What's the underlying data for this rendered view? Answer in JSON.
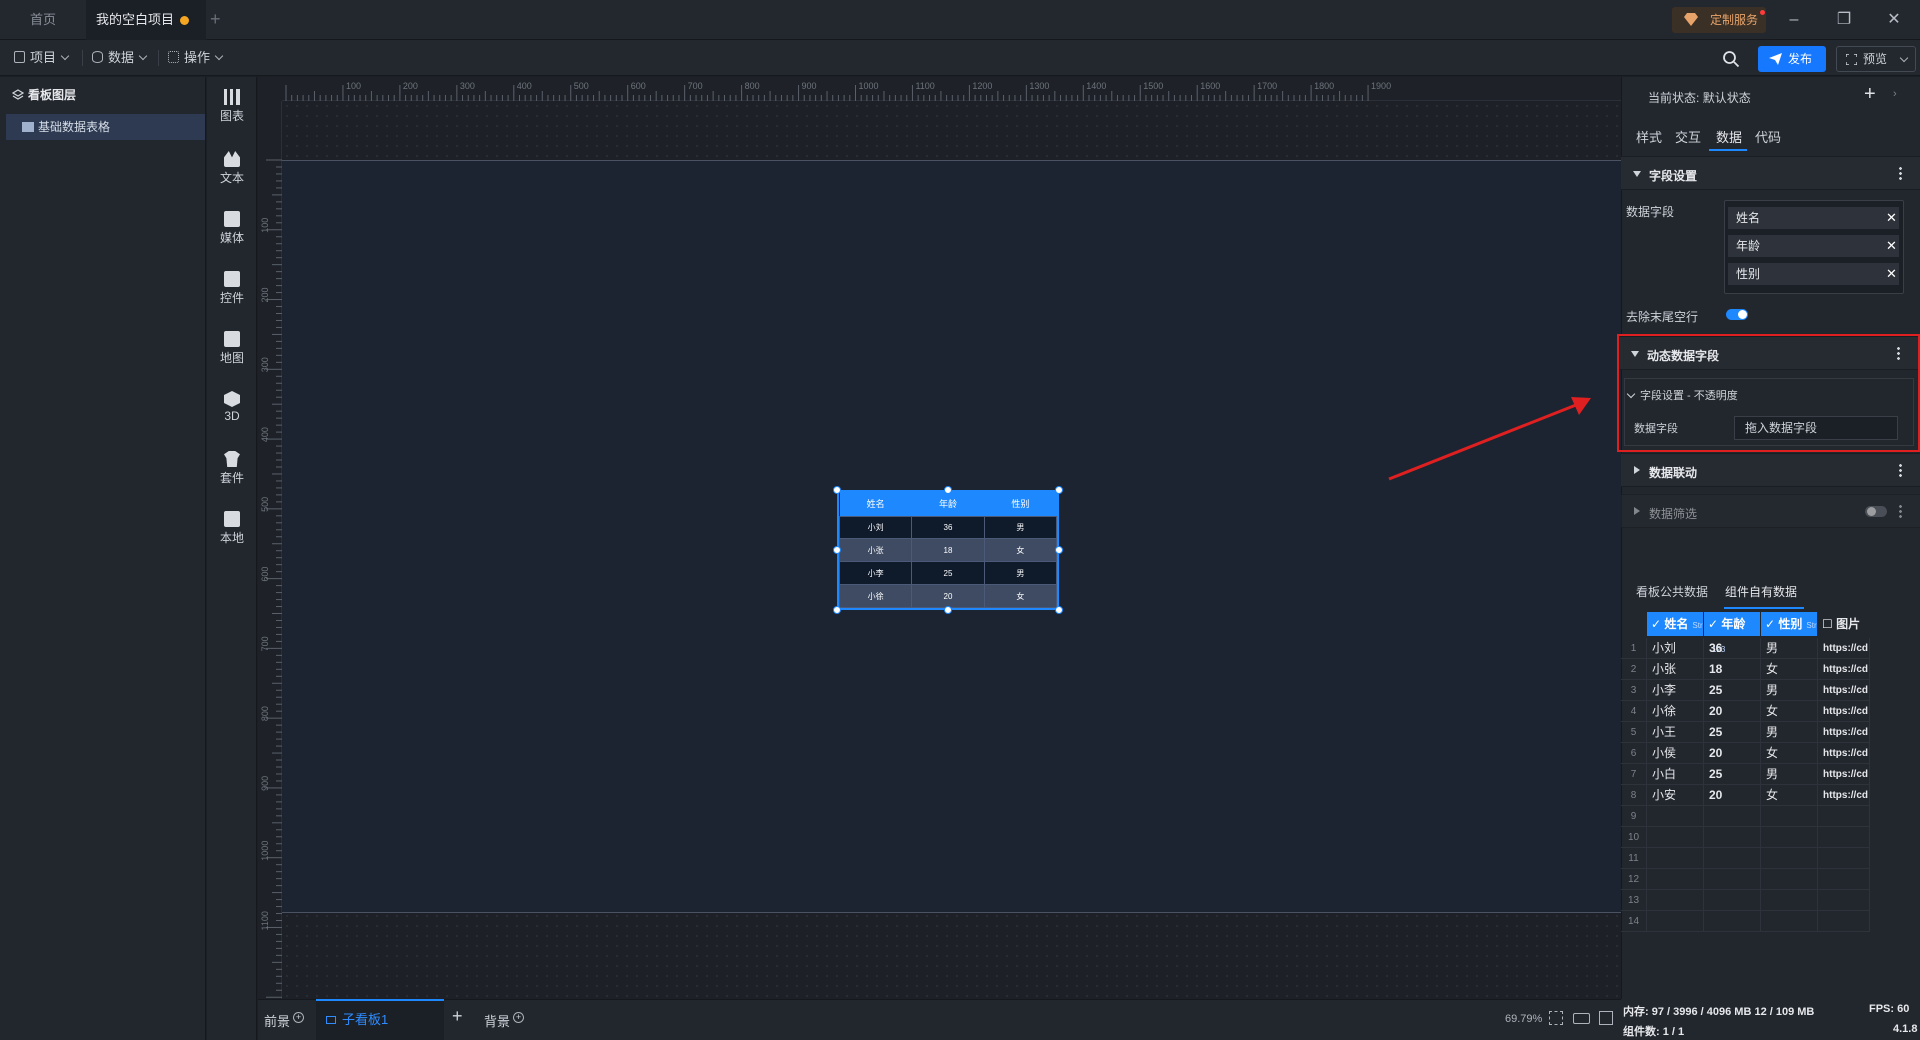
{
  "tabs": [
    {
      "label": "首页"
    },
    {
      "label": "我的空白项目"
    }
  ],
  "vip": {
    "label": "定制服务"
  },
  "toolbar": {
    "project": "项目",
    "data": "数据",
    "ops": "操作",
    "publish": "发布",
    "preview": "预览"
  },
  "layers": {
    "title": "看板图层",
    "items": [
      "基础数据表格"
    ]
  },
  "components": [
    "图表",
    "文本",
    "媒体",
    "控件",
    "地图",
    "3D",
    "套件",
    "本地"
  ],
  "ruler": {
    "top": [
      "100",
      "200",
      "300",
      "400",
      "500",
      "600",
      "700",
      "800",
      "900",
      "1000",
      "1100",
      "1200",
      "1300",
      "1400",
      "1500",
      "1600",
      "1700",
      "1800",
      "1900"
    ],
    "left": [
      "100",
      "200",
      "300",
      "400",
      "500",
      "600",
      "700",
      "800",
      "900",
      "1000",
      "1100"
    ]
  },
  "table_widget": {
    "headers": [
      "姓名",
      "年龄",
      "性别"
    ],
    "rows": [
      [
        "小刘",
        "36",
        "男"
      ],
      [
        "小张",
        "18",
        "女"
      ],
      [
        "小李",
        "25",
        "男"
      ],
      [
        "小徐",
        "20",
        "女"
      ]
    ]
  },
  "bottom": {
    "foreground": "前景",
    "sub_board": "子看板1",
    "background": "背景",
    "zoom": "69.79%"
  },
  "right": {
    "state_label": "当前状态:",
    "state_value": "默认状态",
    "tabs": [
      "样式",
      "交互",
      "数据",
      "代码"
    ],
    "field_settings": "字段设置",
    "data_field_label": "数据字段",
    "fields": [
      "姓名",
      "年龄",
      "性别"
    ],
    "trim_label": "去除末尾空行",
    "trim_on": true,
    "dynamic_title": "动态数据字段",
    "dynamic_sub": "字段设置 - 不透明度",
    "dynamic_field_label": "数据字段",
    "dynamic_placeholder": "拖入数据字段",
    "linkage": "数据联动",
    "filter": "数据筛选",
    "filter_on": false,
    "data_tabs": [
      "看板公共数据",
      "组件自有数据"
    ],
    "grid_headers": [
      {
        "name": "姓名",
        "type": "Str",
        "checked": true
      },
      {
        "name": "年龄",
        "type": "123",
        "checked": true
      },
      {
        "name": "性别",
        "type": "Str",
        "checked": true
      },
      {
        "name": "图片",
        "type": "",
        "checked": false
      }
    ],
    "grid_rows": [
      [
        "1",
        "小刘",
        "36",
        "男",
        "https://cd"
      ],
      [
        "2",
        "小张",
        "18",
        "女",
        "https://cd"
      ],
      [
        "3",
        "小李",
        "25",
        "男",
        "https://cd"
      ],
      [
        "4",
        "小徐",
        "20",
        "女",
        "https://cd"
      ],
      [
        "5",
        "小王",
        "25",
        "男",
        "https://cd"
      ],
      [
        "6",
        "小侯",
        "20",
        "女",
        "https://cd"
      ],
      [
        "7",
        "小白",
        "25",
        "男",
        "https://cd"
      ],
      [
        "8",
        "小安",
        "20",
        "女",
        "https://cd"
      ],
      [
        "9",
        "",
        "",
        "",
        ""
      ],
      [
        "10",
        "",
        "",
        "",
        ""
      ],
      [
        "11",
        "",
        "",
        "",
        ""
      ],
      [
        "12",
        "",
        "",
        "",
        ""
      ],
      [
        "13",
        "",
        "",
        "",
        ""
      ],
      [
        "14",
        "",
        "",
        "",
        ""
      ]
    ]
  },
  "status": {
    "memory": "内存: 97 / 3996 / 4096 MB 12 / 109 MB",
    "fps": "FPS: 60",
    "count": "组件数: 1 / 1",
    "version": "4.1.8"
  },
  "colors": {
    "accent": "#1e88ff",
    "highlight": "#e02020",
    "vip": "#e8a36a"
  }
}
